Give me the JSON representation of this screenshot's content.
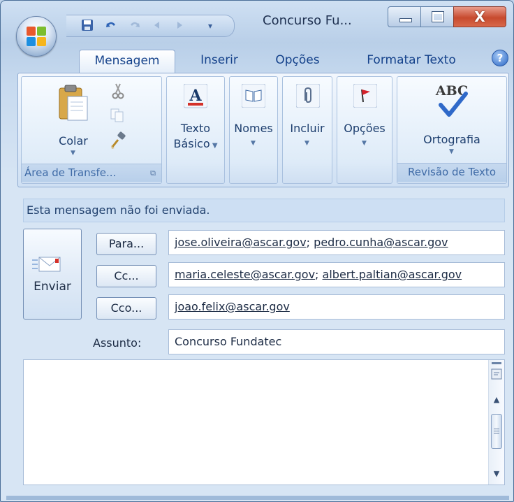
{
  "window": {
    "title": "Concurso Fu...",
    "close_glyph": "X"
  },
  "tabs": [
    "Mensagem",
    "Inserir",
    "Opções",
    "Formatar Texto"
  ],
  "ribbon": {
    "colar_label": "Colar",
    "clipboard_group": "Área de Transfe...",
    "texto_basico_line1": "Texto",
    "texto_basico_line2": "Básico",
    "nomes_label": "Nomes",
    "incluir_label": "Incluir",
    "opcoes_label": "Opções",
    "ortografia_label": "Ortografia",
    "abc_text": "ABC",
    "revisao_group": "Revisão de Texto"
  },
  "message": {
    "info": "Esta mensagem não foi enviada.",
    "send_label": "Enviar",
    "para_label": "Para...",
    "cc_label": "Cc...",
    "cco_label": "Cco...",
    "para_values": [
      "jose.oliveira@ascar.gov",
      "pedro.cunha@ascar.gov"
    ],
    "cc_values": [
      "maria.celeste@ascar.gov",
      "albert.paltian@ascar.gov"
    ],
    "cco_values": [
      "joao.felix@ascar.gov"
    ],
    "subject_label": "Assunto:",
    "subject_value": "Concurso Fundatec",
    "body": ""
  },
  "icons": {
    "office": "office-button-icon",
    "save": "save-icon",
    "undo": "undo-icon",
    "redo": "redo-icon",
    "help": "help-icon",
    "paste": "paste-icon",
    "cut": "cut-icon",
    "copy": "copy-icon",
    "format_painter": "format-painter-icon",
    "font_color": "font-color-icon",
    "address_book": "address-book-icon",
    "attach": "paperclip-icon",
    "flag": "flag-icon",
    "spell_check": "spell-check-icon",
    "send": "envelope-send-icon"
  }
}
